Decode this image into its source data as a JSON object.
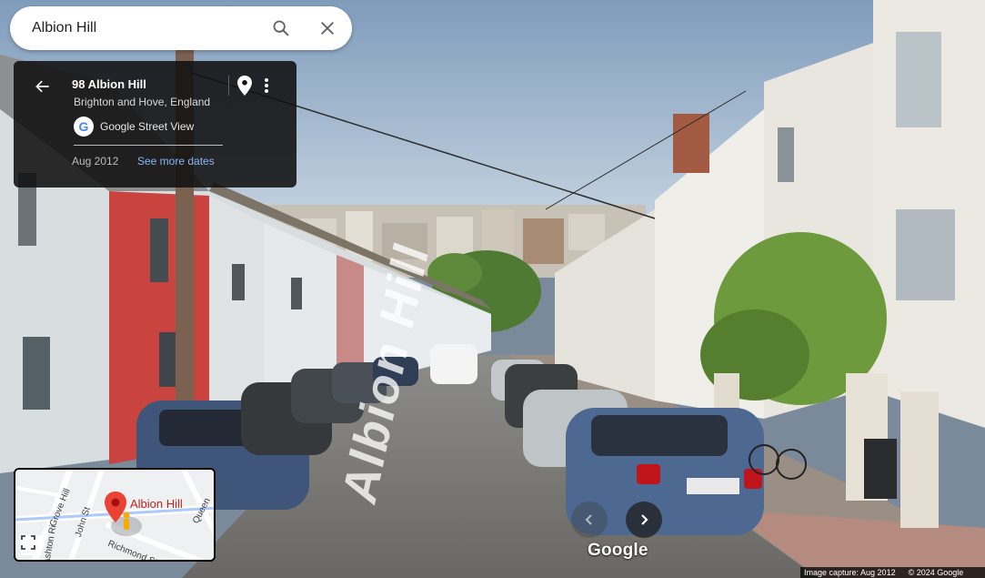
{
  "search": {
    "value": "Albion Hill",
    "search_icon": "search-icon",
    "close_icon": "close-icon"
  },
  "info_card": {
    "title": "98 Albion Hill",
    "subtitle": "Brighton and Hove, England",
    "source_label": "Google Street View",
    "source_logo": "G",
    "capture_date": "Aug 2012",
    "see_more_dates": "See more dates",
    "icons": {
      "back": "arrow-left-icon",
      "pin": "location-pin-icon",
      "more": "more-vert-icon"
    }
  },
  "minimap": {
    "place_label": "Albion Hill",
    "streets": [
      "Grove Hill",
      "John St",
      "Ashton Ri",
      "Richmond St",
      "Queen"
    ],
    "icons": {
      "pin": "map-pin-icon",
      "pegman": "pegman-icon",
      "expand": "fullscreen-icon"
    }
  },
  "scene": {
    "road_marking": "Albion Hill",
    "watermark": "Google"
  },
  "navigation": {
    "prev_icon": "chevron-left-icon",
    "next_icon": "chevron-right-icon"
  },
  "footer": {
    "image_capture": "Image capture: Aug 2012",
    "copyright": "© 2024 Google"
  },
  "colors": {
    "accent_link": "#8ab4f8",
    "pin_red": "#ea4335",
    "card_bg": "#101010"
  }
}
